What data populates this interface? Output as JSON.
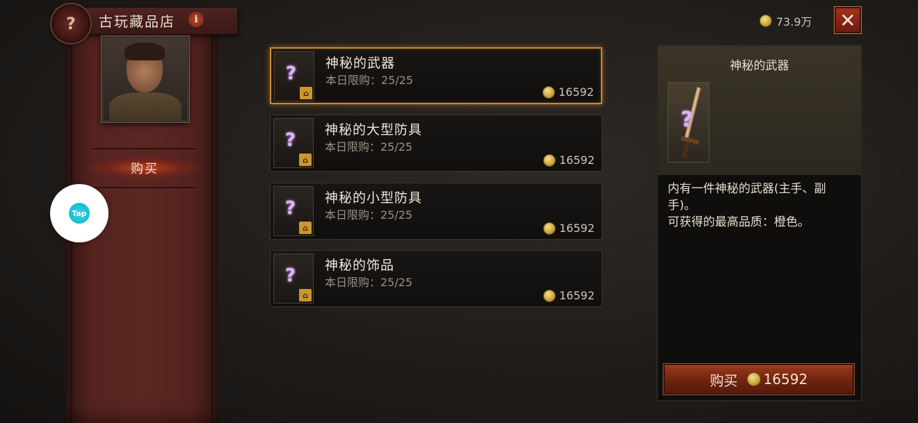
{
  "header": {
    "shop_title": "古玩藏品店",
    "emblem_glyph": "?",
    "info_glyph": "i"
  },
  "sidebar": {
    "nav_buy_label": "购买"
  },
  "overlay": {
    "tap_label": "Tap"
  },
  "currency": {
    "amount": "73.9万"
  },
  "close": {
    "glyph": "✕"
  },
  "items": [
    {
      "name": "神秘的武器",
      "limit": "本日限购：25/25",
      "price": "16592",
      "selected": true
    },
    {
      "name": "神秘的大型防具",
      "limit": "本日限购：25/25",
      "price": "16592",
      "selected": false
    },
    {
      "name": "神秘的小型防具",
      "limit": "本日限购：25/25",
      "price": "16592",
      "selected": false
    },
    {
      "name": "神秘的饰品",
      "limit": "本日限购：25/25",
      "price": "16592",
      "selected": false
    }
  ],
  "item_icon_glyph": "?",
  "item_badge_glyph": "⌂",
  "detail": {
    "title": "神秘的武器",
    "description_line1": "内有一件神秘的武器(主手、副",
    "description_line2": "手)。",
    "description_line3": "可获得的最高品质：橙色。",
    "buy_label": "购买",
    "buy_price": "16592"
  },
  "colors": {
    "selected_border": "#c8892f",
    "coin_gold": "#c9a23a",
    "button_red": "#9a3a1c",
    "banner_red": "#5c2622"
  }
}
